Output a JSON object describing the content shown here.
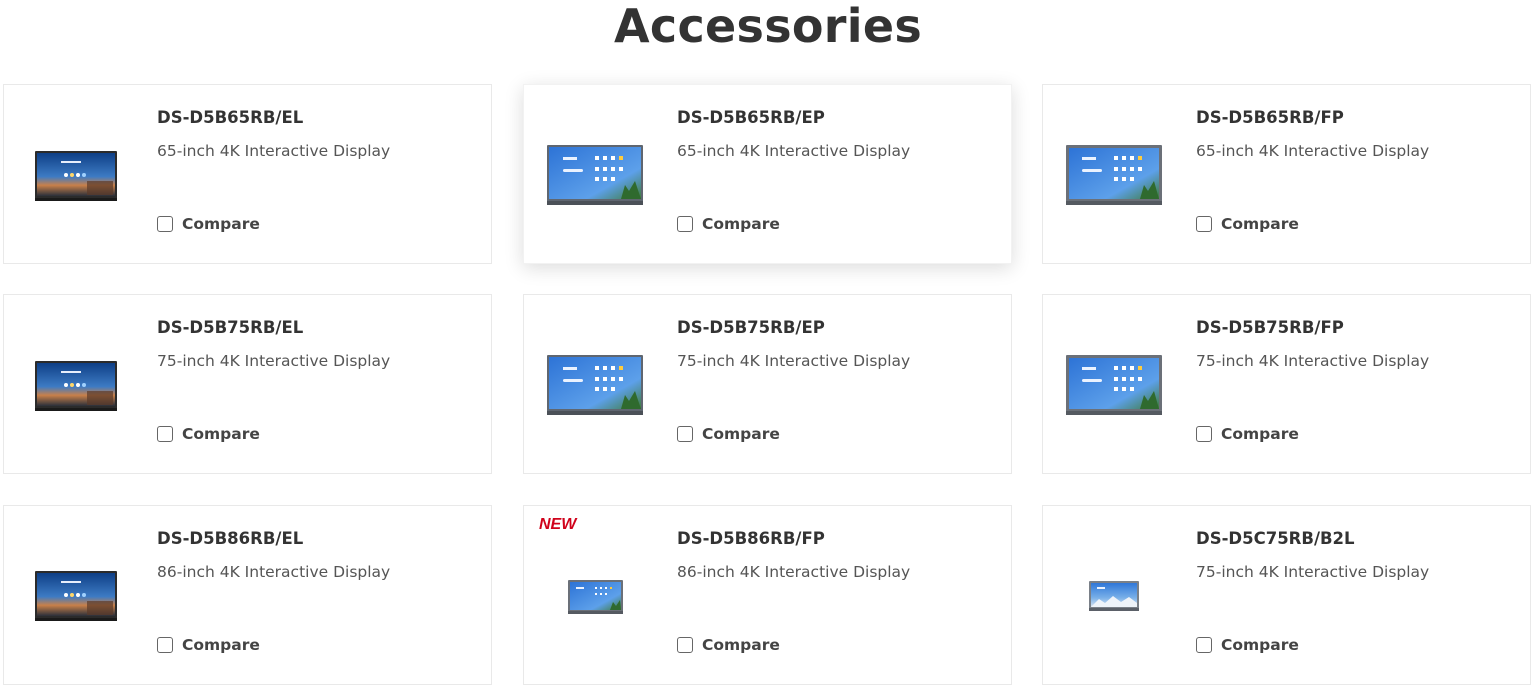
{
  "page": {
    "title": "Accessories"
  },
  "compare_label": "Compare",
  "colors": {
    "badge_new": "#d0021b",
    "text": "#333333",
    "border": "#e9e9e9"
  },
  "products": [
    {
      "model": "DS-D5B65RB/EL",
      "description": "65-inch 4K Interactive Display",
      "badge": "",
      "icon": "interactive-display-el-image"
    },
    {
      "model": "DS-D5B65RB/EP",
      "description": "65-inch 4K Interactive Display",
      "badge": "",
      "icon": "interactive-display-ep-image"
    },
    {
      "model": "DS-D5B65RB/FP",
      "description": "65-inch 4K Interactive Display",
      "badge": "",
      "icon": "interactive-display-fp-image"
    },
    {
      "model": "DS-D5B75RB/EL",
      "description": "75-inch 4K Interactive Display",
      "badge": "",
      "icon": "interactive-display-el-image"
    },
    {
      "model": "DS-D5B75RB/EP",
      "description": "75-inch 4K Interactive Display",
      "badge": "",
      "icon": "interactive-display-ep-image"
    },
    {
      "model": "DS-D5B75RB/FP",
      "description": "75-inch 4K Interactive Display",
      "badge": "",
      "icon": "interactive-display-fp-image"
    },
    {
      "model": "DS-D5B86RB/EL",
      "description": "86-inch 4K Interactive Display",
      "badge": "",
      "icon": "interactive-display-el-image"
    },
    {
      "model": "DS-D5B86RB/FP",
      "description": "86-inch 4K Interactive Display",
      "badge": "NEW",
      "icon": "interactive-display-small-image"
    },
    {
      "model": "DS-D5C75RB/B2L",
      "description": "75-inch 4K Interactive Display",
      "badge": "",
      "icon": "interactive-display-small-image"
    }
  ]
}
